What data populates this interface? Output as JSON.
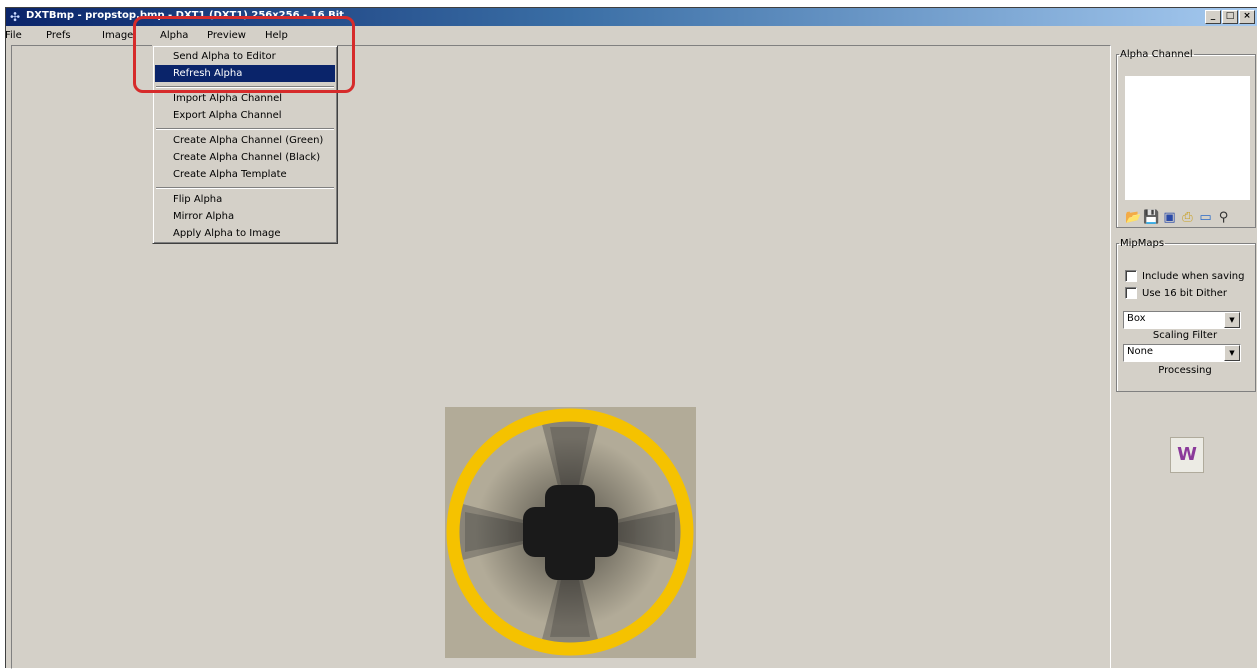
{
  "window": {
    "title": "DXTBmp - propstop.bmp - DXT1 (DXT1) 256x256 - 16 Bit",
    "icon": "dxtbmp-app-icon",
    "controls": [
      "_",
      "□",
      "×"
    ]
  },
  "menubar": {
    "items": [
      "File",
      "Prefs",
      "Image",
      "Alpha",
      "Preview",
      "Help"
    ]
  },
  "alpha_menu": {
    "group1": [
      "Send Alpha to Editor",
      "Refresh Alpha"
    ],
    "group2": [
      "Import Alpha Channel",
      "Export Alpha Channel"
    ],
    "group3": [
      "Create Alpha Channel (Green)",
      "Create Alpha Channel (Black)",
      "Create Alpha Template"
    ],
    "group4": [
      "Flip Alpha",
      "Mirror Alpha",
      "Apply Alpha to Image"
    ],
    "highlighted": "Refresh Alpha"
  },
  "side_panel": {
    "alpha_channel": {
      "title": "Alpha Channel",
      "tool_icons": [
        "open-folder-icon",
        "save-icon",
        "load-icon",
        "print-icon",
        "monitor-icon",
        "magnifier-icon"
      ]
    },
    "mipmaps": {
      "title": "MipMaps",
      "include_label": "Include when saving",
      "dither_label": "Use 16 bit Dither",
      "scaling_value": "Box",
      "scaling_caption": "Scaling Filter",
      "processing_value": "None",
      "processing_caption": "Processing"
    },
    "logo_icon": "w-logo-icon"
  },
  "preview": {
    "ring_color": "#f5c200",
    "background_color": "#b2ab98",
    "cross_color": "#1a1a1a"
  },
  "colors": {
    "callout": "#d62b2b",
    "selection": "#0a246a",
    "window_bg": "#d4d0c8"
  }
}
